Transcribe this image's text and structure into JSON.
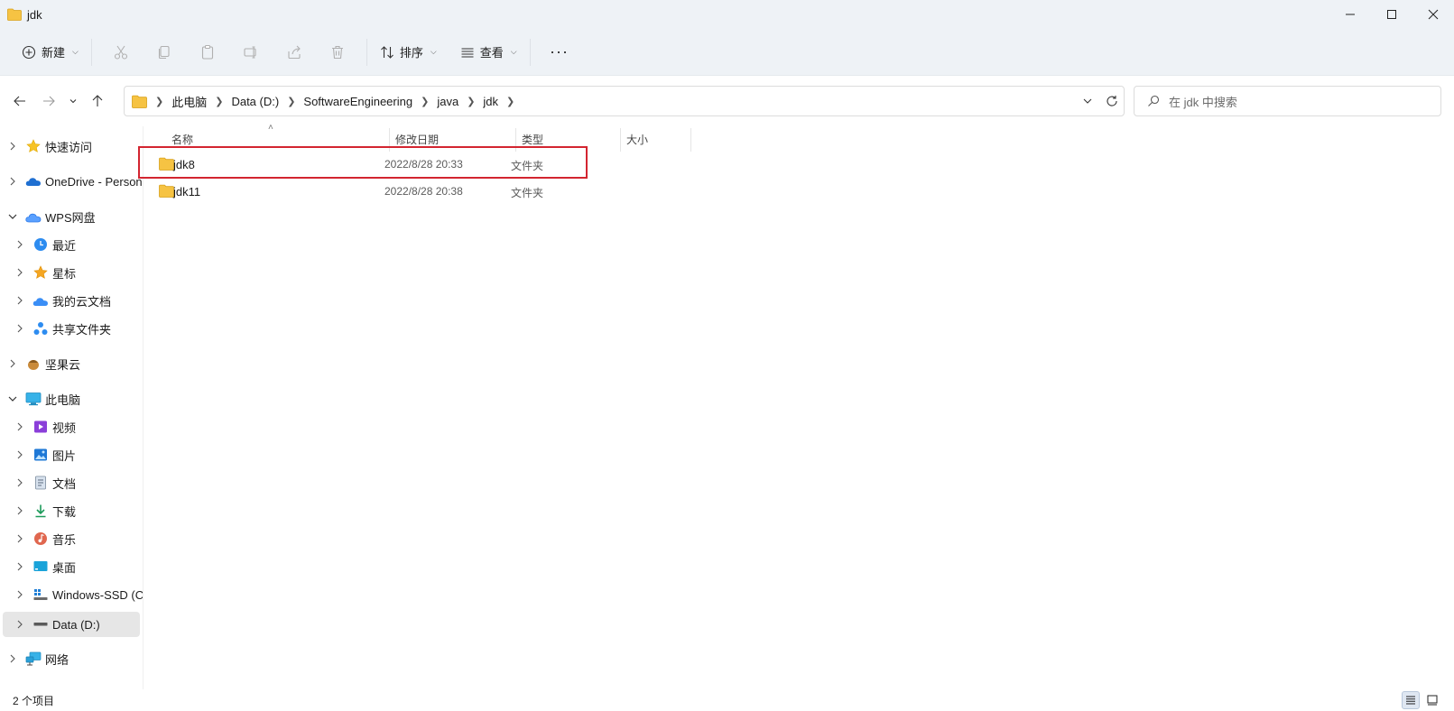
{
  "window": {
    "title": "jdk",
    "controls": [
      "minimize",
      "maximize",
      "close"
    ]
  },
  "toolbar": {
    "new_label": "新建",
    "sort_label": "排序",
    "view_label": "查看",
    "more_label": "···",
    "icons": [
      "cut-icon",
      "copy-icon",
      "paste-icon",
      "rename-icon",
      "share-icon",
      "delete-icon"
    ]
  },
  "address": {
    "crumbs": [
      "此电脑",
      "Data (D:)",
      "SoftwareEngineering",
      "java",
      "jdk"
    ]
  },
  "search": {
    "placeholder": "在 jdk 中搜索"
  },
  "sidebar": {
    "items": [
      {
        "label": "快速访问"
      },
      {
        "label": "OneDrive - Personal"
      },
      {
        "label": "WPS网盘"
      },
      {
        "label": "最近"
      },
      {
        "label": "星标"
      },
      {
        "label": "我的云文档"
      },
      {
        "label": "共享文件夹"
      },
      {
        "label": "坚果云"
      },
      {
        "label": "此电脑"
      },
      {
        "label": "视频"
      },
      {
        "label": "图片"
      },
      {
        "label": "文档"
      },
      {
        "label": "下载"
      },
      {
        "label": "音乐"
      },
      {
        "label": "桌面"
      },
      {
        "label": "Windows-SSD (C:)"
      },
      {
        "label": "Data (D:)"
      },
      {
        "label": "网络"
      }
    ]
  },
  "files": {
    "columns": {
      "name": "名称",
      "date": "修改日期",
      "type": "类型",
      "size": "大小"
    },
    "rows": [
      {
        "name": "jdk8",
        "date": "2022/8/28 20:33",
        "type": "文件夹"
      },
      {
        "name": "jdk11",
        "date": "2022/8/28 20:38",
        "type": "文件夹"
      }
    ]
  },
  "status": {
    "item_count": "2 个项目"
  },
  "colors": {
    "folder": "#f6c343",
    "highlight": "#d32530",
    "chrome": "#eef2f6"
  }
}
